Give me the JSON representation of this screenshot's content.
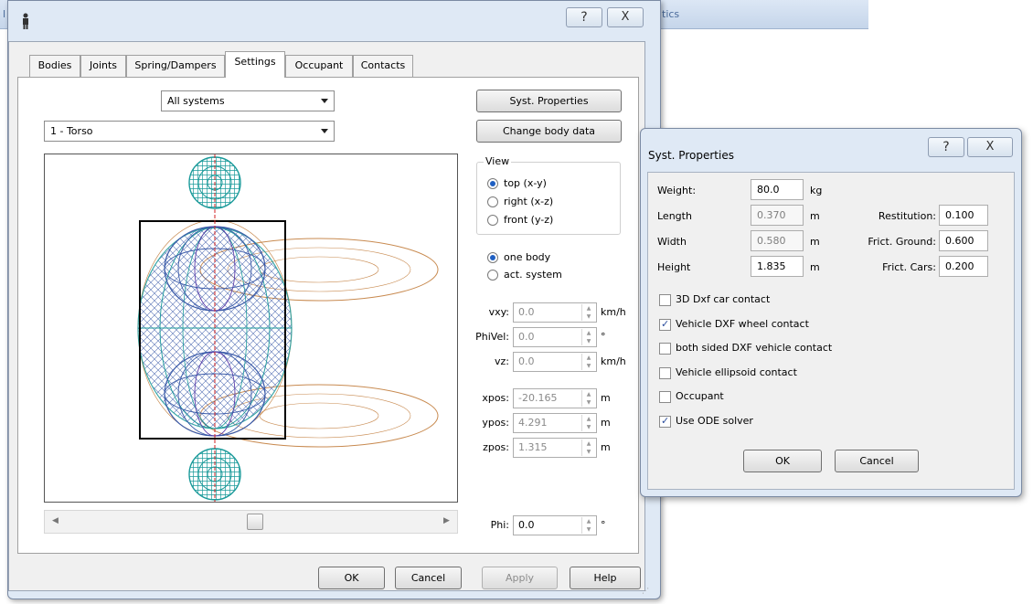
{
  "background": {
    "fragment_left": "l",
    "fragment_right": "tics"
  },
  "main_dialog": {
    "help_glyph": "?",
    "close_glyph": "X",
    "tabs": [
      {
        "label": "Bodies"
      },
      {
        "label": "Joints"
      },
      {
        "label": "Spring/Dampers"
      },
      {
        "label": "Settings"
      },
      {
        "label": "Occupant"
      },
      {
        "label": "Contacts"
      }
    ],
    "active_tab": "Settings",
    "system_combo": "All systems",
    "body_combo": "1 - Torso",
    "syst_properties_button": "Syst. Properties",
    "change_body_data_button": "Change body data",
    "view_group": {
      "title": "View",
      "options": [
        "top (x-y)",
        "right (x-z)",
        "front (y-z)"
      ],
      "selected": "top (x-y)"
    },
    "scope": {
      "options": [
        "one body",
        "act. system"
      ],
      "selected": "one body"
    },
    "fields": {
      "vxy": {
        "label": "vxy:",
        "value": "0.0",
        "unit": "km/h"
      },
      "phivel": {
        "label": "PhiVel:",
        "value": "0.0",
        "unit": "°"
      },
      "vz": {
        "label": "vz:",
        "value": "0.0",
        "unit": "km/h"
      },
      "xpos": {
        "label": "xpos:",
        "value": "-20.165",
        "unit": "m"
      },
      "ypos": {
        "label": "ypos:",
        "value": "4.291",
        "unit": "m"
      },
      "zpos": {
        "label": "zpos:",
        "value": "1.315",
        "unit": "m"
      },
      "phi": {
        "label": "Phi:",
        "value": "0.0",
        "unit": "°"
      }
    },
    "buttons": {
      "ok": "OK",
      "cancel": "Cancel",
      "apply": "Apply",
      "help": "Help"
    },
    "colors": {
      "model_teal": "#1a9a9a",
      "model_blue": "#3a5aa8",
      "model_orange": "#c88a50"
    }
  },
  "syst_properties_dialog": {
    "title": "Syst. Properties",
    "help_glyph": "?",
    "close_glyph": "X",
    "weight": {
      "label": "Weight:",
      "value": "80.0",
      "unit": "kg"
    },
    "length": {
      "label": "Length",
      "value": "0.370",
      "unit": "m"
    },
    "width": {
      "label": "Width",
      "value": "0.580",
      "unit": "m"
    },
    "height": {
      "label": "Height",
      "value": "1.835",
      "unit": "m"
    },
    "restitution": {
      "label": "Restitution:",
      "value": "0.100"
    },
    "frict_ground": {
      "label": "Frict. Ground:",
      "value": "0.600"
    },
    "frict_cars": {
      "label": "Frict. Cars:",
      "value": "0.200"
    },
    "checkboxes": [
      {
        "label": "3D Dxf car contact",
        "checked": false
      },
      {
        "label": "Vehicle DXF wheel contact",
        "checked": true
      },
      {
        "label": "both sided DXF vehicle contact",
        "checked": false
      },
      {
        "label": "Vehicle ellipsoid contact",
        "checked": false
      },
      {
        "label": "Occupant",
        "checked": false
      },
      {
        "label": "Use ODE solver",
        "checked": true
      }
    ],
    "ok": "OK",
    "cancel": "Cancel"
  }
}
